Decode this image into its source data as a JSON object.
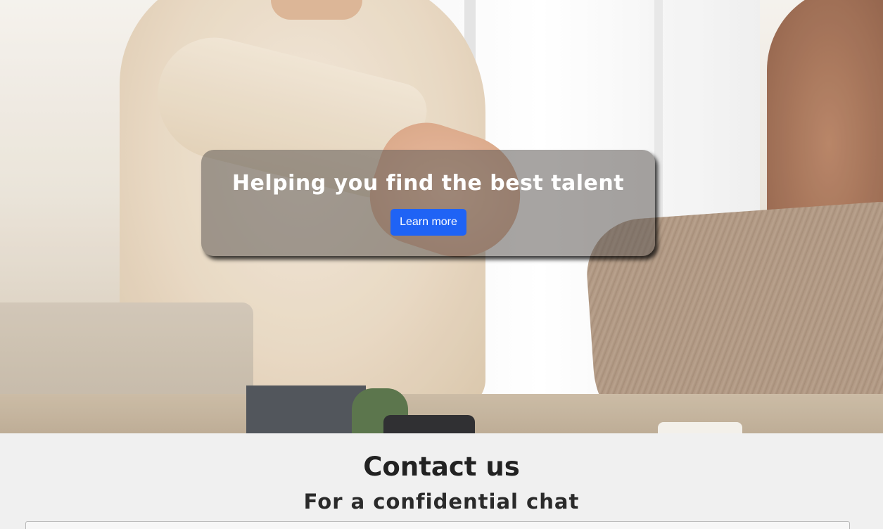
{
  "hero": {
    "heading": "Helping you find the best talent",
    "button_label": "Learn more",
    "button_color": "#1f63f5",
    "background_image": "handshake-photo"
  },
  "contact": {
    "heading": "Contact us",
    "subheading": "For a confidential chat"
  }
}
